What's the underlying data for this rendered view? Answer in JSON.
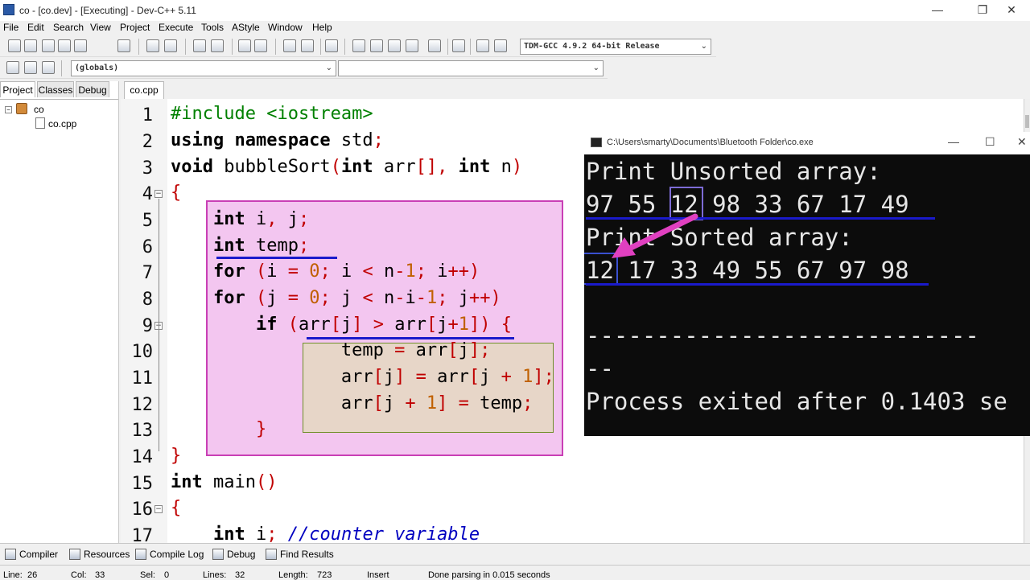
{
  "window": {
    "title": "co - [co.dev] - [Executing] - Dev-C++ 5.11"
  },
  "menu": [
    "File",
    "Edit",
    "Search",
    "View",
    "Project",
    "Execute",
    "Tools",
    "AStyle",
    "Window",
    "Help"
  ],
  "toolbar": {
    "compiler_select": "TDM-GCC 4.9.2 64-bit Release",
    "scope_select": "(globals)"
  },
  "left_panel": {
    "tabs": [
      "Project",
      "Classes",
      "Debug"
    ],
    "tree": {
      "project": "co",
      "file": "co.cpp"
    }
  },
  "editor": {
    "tab": "co.cpp",
    "line_numbers": [
      "1",
      "2",
      "3",
      "4",
      "5",
      "6",
      "7",
      "8",
      "9",
      "10",
      "11",
      "12",
      "13",
      "14",
      "15",
      "16",
      "17"
    ]
  },
  "console": {
    "title": "C:\\Users\\smarty\\Documents\\Bluetooth Folder\\co.exe",
    "lines": [
      "Print Unsorted array:",
      "97 55 12 98 33 67 17 49",
      "Print Sorted array:",
      "12 17 33 49 55 67 97 98",
      "",
      "----------------------------",
      "--",
      "Process exited after 0.1403 se"
    ]
  },
  "bottom_tabs": [
    "Compiler",
    "Resources",
    "Compile Log",
    "Debug",
    "Find Results"
  ],
  "status": {
    "line": "Line:",
    "line_val": "26",
    "col": "Col:",
    "col_val": "33",
    "sel": "Sel:",
    "sel_val": "0",
    "lines": "Lines:",
    "lines_val": "32",
    "length": "Length:",
    "length_val": "723",
    "mode": "Insert",
    "message": "Done parsing in 0.015 seconds"
  },
  "colors": {
    "highlight_box": "#f3c6f0",
    "highlight_border": "#c93fb5",
    "inner_box": "#e7d6c8",
    "inner_border": "#6f8f2a",
    "underline": "#1a1acb",
    "arrow": "#e040c0",
    "console_bg": "#0c0c0c"
  }
}
